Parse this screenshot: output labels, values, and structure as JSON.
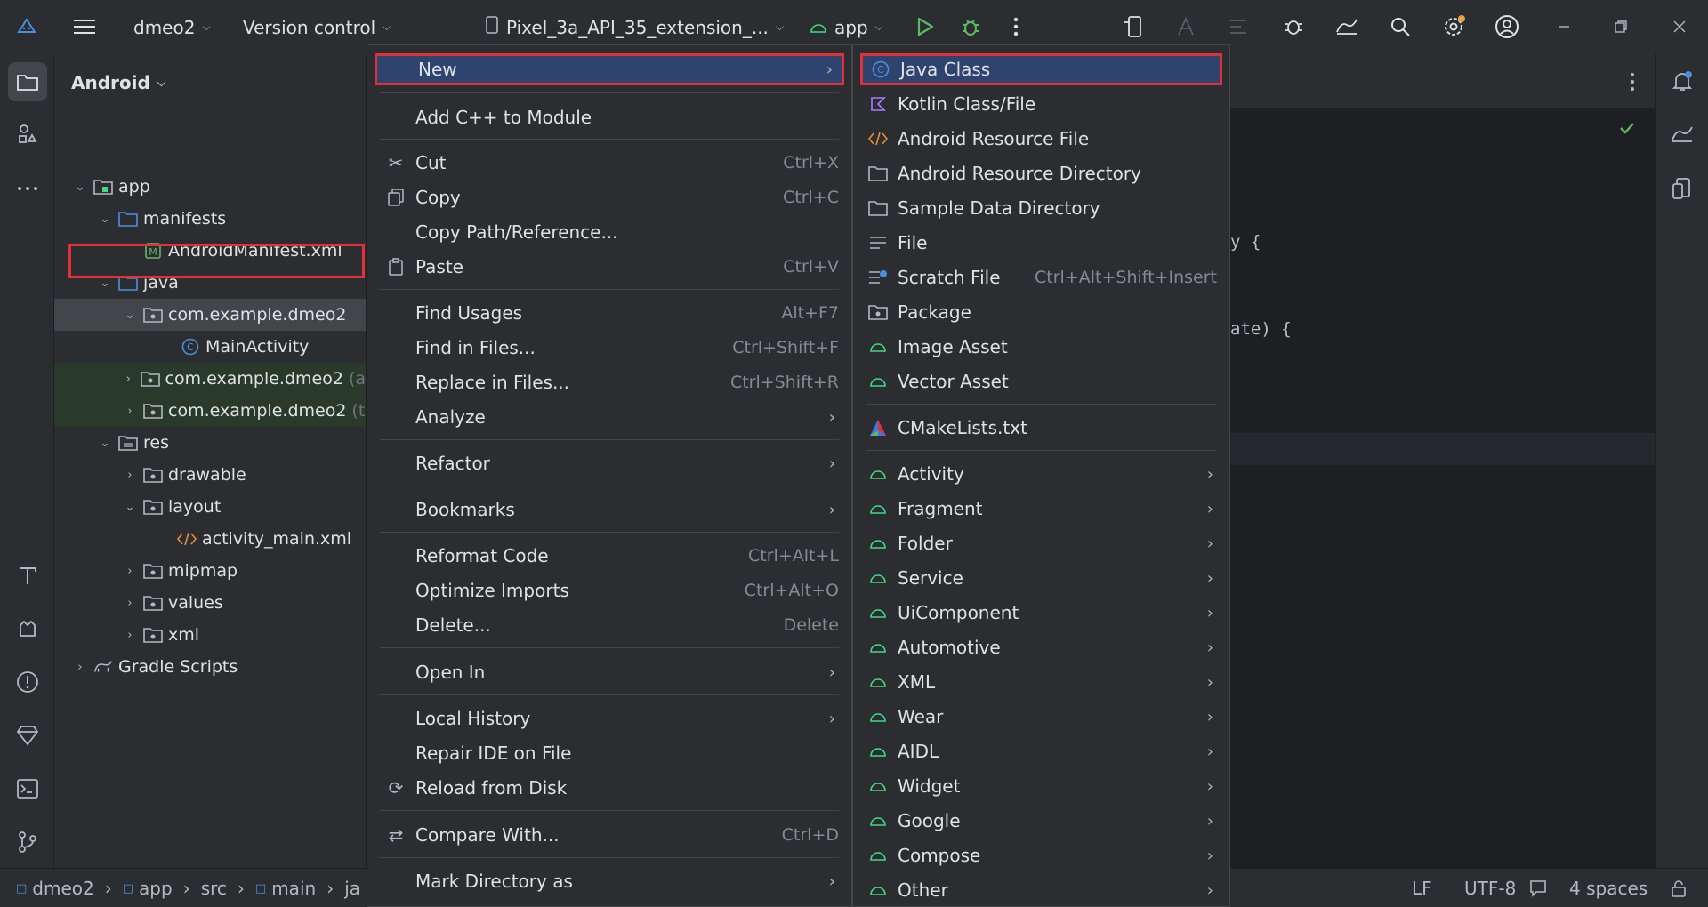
{
  "titlebar": {
    "project_name": "dmeo2",
    "vcs": "Version control",
    "device": "Pixel_3a_API_35_extension_...",
    "run_config": "app"
  },
  "project_panel": {
    "view": "Android",
    "tree": [
      {
        "label": "app",
        "suffix": ""
      },
      {
        "label": "manifests",
        "suffix": ""
      },
      {
        "label": "AndroidManifest.xml",
        "suffix": ""
      },
      {
        "label": "java",
        "suffix": ""
      },
      {
        "label": "com.example.dmeo2",
        "suffix": ""
      },
      {
        "label": "MainActivity",
        "suffix": ""
      },
      {
        "label": "com.example.dmeo2",
        "suffix": "(a"
      },
      {
        "label": "com.example.dmeo2",
        "suffix": "(t"
      },
      {
        "label": "res",
        "suffix": ""
      },
      {
        "label": "drawable",
        "suffix": ""
      },
      {
        "label": "layout",
        "suffix": ""
      },
      {
        "label": "activity_main.xml",
        "suffix": ""
      },
      {
        "label": "mipmap",
        "suffix": ""
      },
      {
        "label": "values",
        "suffix": ""
      },
      {
        "label": "xml",
        "suffix": ""
      },
      {
        "label": "Gradle Scripts",
        "suffix": ""
      }
    ]
  },
  "context_menu": {
    "new": "New",
    "add_cpp": "Add C++ to Module",
    "cut": "Cut",
    "cut_sc": "Ctrl+X",
    "copy": "Copy",
    "copy_sc": "Ctrl+C",
    "copy_path": "Copy Path/Reference...",
    "paste": "Paste",
    "paste_sc": "Ctrl+V",
    "find_usages": "Find Usages",
    "find_usages_sc": "Alt+F7",
    "find_in_files": "Find in Files...",
    "find_in_files_sc": "Ctrl+Shift+F",
    "replace_in_files": "Replace in Files...",
    "replace_in_files_sc": "Ctrl+Shift+R",
    "analyze": "Analyze",
    "refactor": "Refactor",
    "bookmarks": "Bookmarks",
    "reformat": "Reformat Code",
    "reformat_sc": "Ctrl+Alt+L",
    "optimize": "Optimize Imports",
    "optimize_sc": "Ctrl+Alt+O",
    "delete": "Delete...",
    "delete_sc": "Delete",
    "open_in": "Open In",
    "local_history": "Local History",
    "repair": "Repair IDE on File",
    "reload": "Reload from Disk",
    "compare": "Compare With...",
    "compare_sc": "Ctrl+D",
    "mark_dir": "Mark Directory as"
  },
  "new_submenu": {
    "java_class": "Java Class",
    "kotlin": "Kotlin Class/File",
    "res_file": "Android Resource File",
    "res_dir": "Android Resource Directory",
    "sample_dir": "Sample Data Directory",
    "file": "File",
    "scratch": "Scratch File",
    "scratch_sc": "Ctrl+Alt+Shift+Insert",
    "package": "Package",
    "image_asset": "Image Asset",
    "vector_asset": "Vector Asset",
    "cmake": "CMakeLists.txt",
    "activity": "Activity",
    "fragment": "Fragment",
    "folder": "Folder",
    "service": "Service",
    "uicomponent": "UiComponent",
    "automotive": "Automotive",
    "xml": "XML",
    "wear": "Wear",
    "aidl": "AIDL",
    "widget": "Widget",
    "google": "Google",
    "compose": "Compose",
    "other": "Other"
  },
  "editor": {
    "line1": "y {",
    "line2": "ate) {"
  },
  "statusbar": {
    "crumbs": [
      "dmeo2",
      "app",
      "src",
      "main",
      "ja"
    ],
    "line_sep": "LF",
    "encoding": "UTF-8",
    "indent": "4 spaces"
  },
  "colors": {
    "accent": "#2e436e",
    "highlight_outline": "#e0303a",
    "android_green": "#3ddc84"
  }
}
